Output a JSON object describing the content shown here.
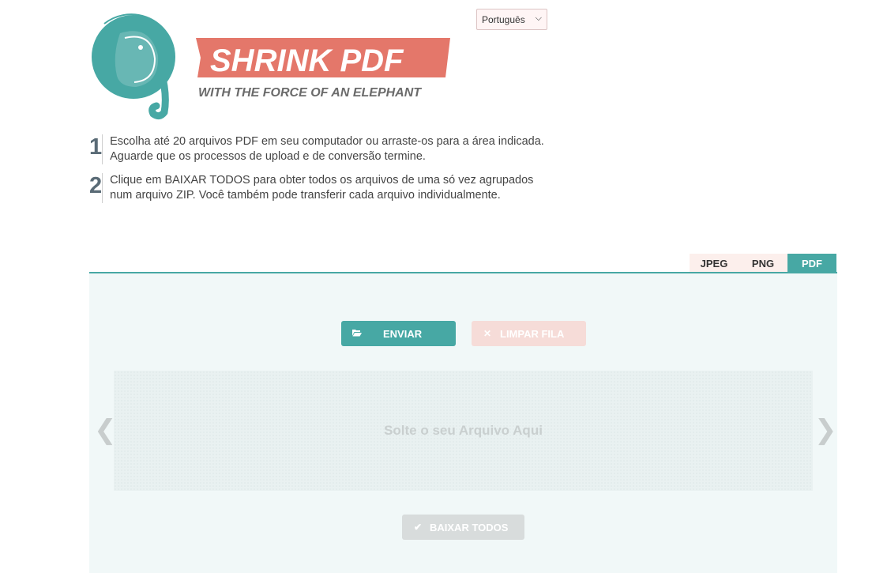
{
  "brand": {
    "name": "SHRINK PDF",
    "tagline": "WITH THE FORCE OF AN ELEPHANT",
    "colors": {
      "teal": "#47a8a4",
      "coral": "#e4776a"
    }
  },
  "language": {
    "selected": "Português"
  },
  "steps": [
    {
      "number": "1",
      "text": "Escolha até 20 arquivos PDF em seu computador ou arraste-os para a área indicada. Aguarde que os processos de upload e de conversão termine."
    },
    {
      "number": "2",
      "text": "Clique em BAIXAR TODOS para obter todos os arquivos de uma só vez agrupados num arquivo ZIP. Você também pode transferir cada arquivo individualmente."
    }
  ],
  "tabs": [
    {
      "label": "JPEG",
      "active": false
    },
    {
      "label": "PNG",
      "active": false
    },
    {
      "label": "PDF",
      "active": true
    }
  ],
  "uploader": {
    "send_label": "ENVIAR",
    "clear_label": "LIMPAR FILA",
    "drop_text": "Solte o seu Arquivo Aqui",
    "download_all_label": "BAIXAR TODOS",
    "prev_arrow": "❮",
    "next_arrow": "❯"
  }
}
